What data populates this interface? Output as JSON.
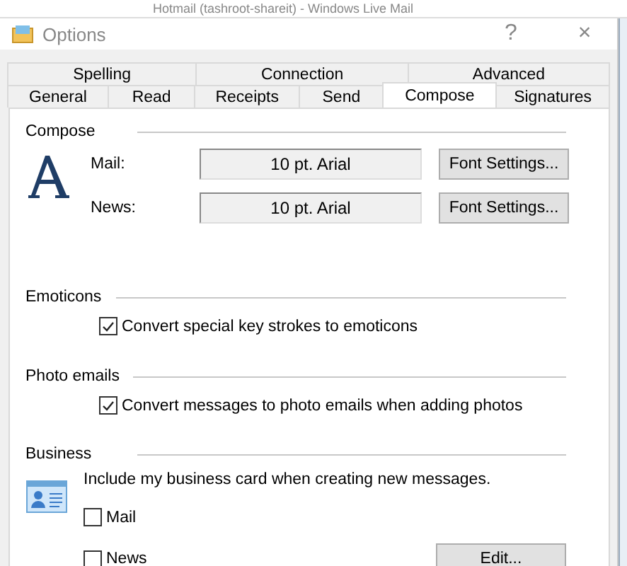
{
  "background_window": {
    "title": "Hotmail (tashroot-shareit) - Windows Live Mail"
  },
  "window": {
    "title": "Options",
    "help": "?",
    "close": "×"
  },
  "tab_rows": [
    [
      {
        "label": "Spelling",
        "selected": false
      },
      {
        "label": "Connection",
        "selected": false
      },
      {
        "label": "Advanced",
        "selected": false
      }
    ],
    [
      {
        "label": "General",
        "selected": false
      },
      {
        "label": "Read",
        "selected": false
      },
      {
        "label": "Receipts",
        "selected": false
      },
      {
        "label": "Send",
        "selected": false
      },
      {
        "label": "Compose",
        "selected": true
      },
      {
        "label": "Signatures",
        "selected": false
      }
    ]
  ],
  "compose": {
    "heading": "Compose",
    "fonts": [
      {
        "label": "Mail:",
        "value": "10 pt. Arial",
        "button": "Font Settings..."
      },
      {
        "label": "News:",
        "value": "10 pt. Arial",
        "button": "Font Settings..."
      }
    ]
  },
  "emoticons": {
    "heading": "Emoticons",
    "options": [
      {
        "label": "Convert special key strokes to emoticons",
        "checked": true
      }
    ]
  },
  "photo_emails": {
    "heading": "Photo emails",
    "options": [
      {
        "label": "Convert messages to photo emails when adding photos",
        "checked": true
      }
    ]
  },
  "business": {
    "heading": "Business",
    "text": "Include my business card when creating new messages.",
    "options": [
      {
        "label": "Mail",
        "checked": false
      },
      {
        "label": "News",
        "checked": false
      }
    ],
    "button": "Edit..."
  }
}
